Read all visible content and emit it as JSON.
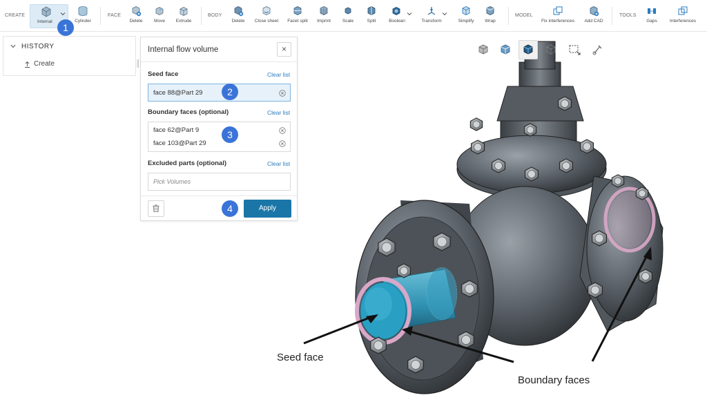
{
  "toolbar": {
    "groups": {
      "create": "CREATE",
      "face": "FACE",
      "body": "BODY",
      "model": "MODEL",
      "tools": "TOOLS"
    },
    "create": {
      "internal": "Internal",
      "cylinder": "Cylinder"
    },
    "face": {
      "delete": "Delete",
      "move": "Move",
      "extrude": "Extrude"
    },
    "body": {
      "delete": "Delete",
      "close_sheet": "Close sheet",
      "facet_split": "Facet split",
      "imprint": "Imprint",
      "scale": "Scale",
      "split": "Split",
      "boolean": "Boolean",
      "transform": "Transform",
      "simplify": "Simplify",
      "wrap": "Wrap"
    },
    "model": {
      "fix_interferences": "Fix interferences",
      "add_cad": "Add CAD"
    },
    "tools": {
      "gaps": "Gaps",
      "interferences": "Interferences"
    }
  },
  "history": {
    "title": "HISTORY",
    "items": [
      {
        "label": "Create"
      }
    ]
  },
  "dialog": {
    "title": "Internal flow volume",
    "close": "×",
    "seed_face": {
      "label": "Seed face",
      "clear": "Clear list",
      "items": [
        "face 88@Part 29"
      ]
    },
    "boundary_faces": {
      "label": "Boundary faces (optional)",
      "clear": "Clear list",
      "items": [
        "face 62@Part 9",
        "face 103@Part 29"
      ]
    },
    "excluded_parts": {
      "label": "Excluded parts (optional)",
      "clear": "Clear list",
      "placeholder": "Pick Volumes"
    },
    "apply": "Apply"
  },
  "steps": [
    "1",
    "2",
    "3",
    "4"
  ],
  "annotations": {
    "seed_face": "Seed face",
    "boundary_faces": "Boundary faces"
  },
  "colors": {
    "accent": "#1b76a8",
    "step_badge": "#3b74d8",
    "link": "#2a7bbf",
    "seed_highlight": "#2a9fc4",
    "boundary_highlight": "#d9a7c8",
    "model_metal": "#5a6168"
  }
}
